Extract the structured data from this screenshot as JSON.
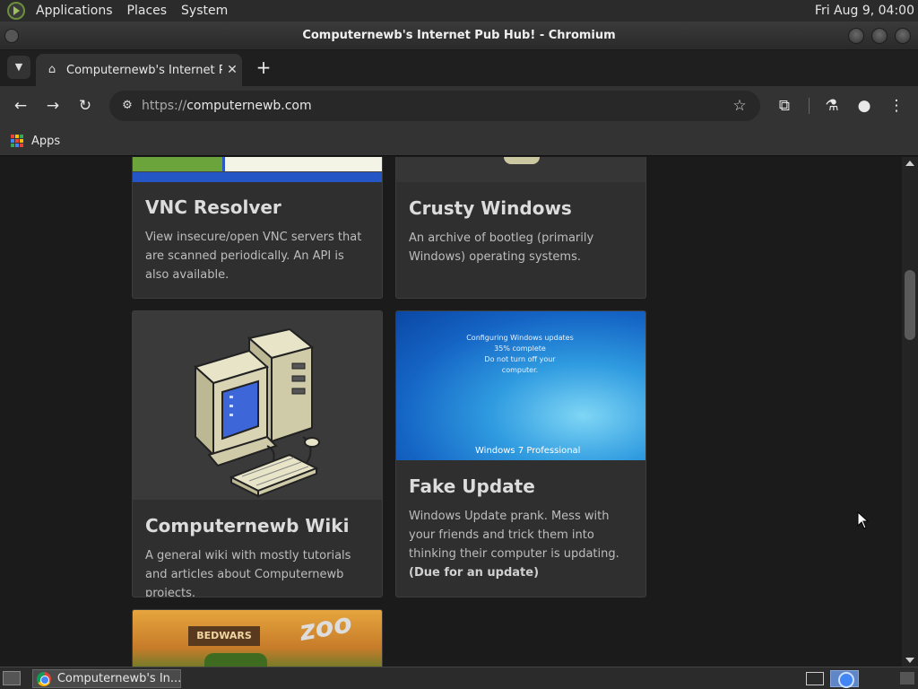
{
  "top_panel": {
    "menus": [
      "Applications",
      "Places",
      "System"
    ],
    "clock": "Fri Aug 9, 04:00"
  },
  "window": {
    "title": "Computernewb's Internet Pub Hub! - Chromium"
  },
  "tabs": [
    {
      "title": "Computernewb's Internet Pub Hub!",
      "favicon": "computer-favicon-icon",
      "active": true
    }
  ],
  "toolbar": {
    "back_icon": "←",
    "forward_icon": "→",
    "reload_icon": "↻",
    "url_scheme": "https://",
    "url_host": "computernewb.com",
    "star_icon": "☆",
    "extensions_icon": "⧉",
    "labs_icon": "⚗",
    "profile_icon": "●",
    "menu_icon": "⋮"
  },
  "bookmarks": {
    "apps_label": "Apps",
    "apps_colors": [
      "#ea4335",
      "#fbbc05",
      "#34a853",
      "#4285f4",
      "#ea4335",
      "#fbbc05",
      "#34a853",
      "#4285f4",
      "#ea4335"
    ]
  },
  "cards": {
    "vnc": {
      "title": "VNC Resolver",
      "desc": "View insecure/open VNC servers that are scanned periodically. An API is also available."
    },
    "crusty": {
      "title": "Crusty Windows",
      "desc": "An archive of bootleg (primarily Windows) operating systems."
    },
    "wiki": {
      "title": "Computernewb Wiki",
      "desc": "A general wiki with mostly tutorials and articles about Computernewb projects."
    },
    "update": {
      "title": "Fake Update",
      "desc": "Windows Update prank. Mess with your friends and trick them into thinking their computer is updating.",
      "note": "(Due for an update)",
      "screen_line1": "Configuring Windows updates",
      "screen_line2": "35% complete",
      "screen_line3": "Do not turn off your computer.",
      "screen_logo": "Windows 7 Professional"
    },
    "zoo": {
      "sign": "BEDWARS",
      "zoo_text": "zoo"
    }
  },
  "taskbar": {
    "window_item": "Computernewb's In..."
  }
}
